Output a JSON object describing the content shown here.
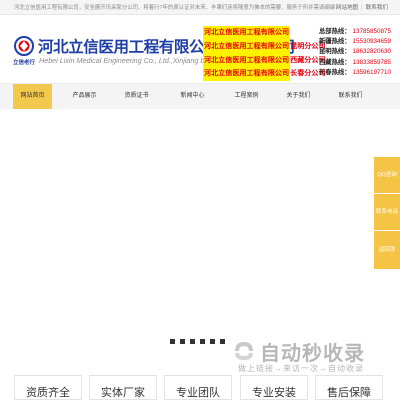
{
  "topbar": {
    "intro": "河北立信医用工程有限公司，安全展开讯采家分公司、将着行7年的原认证对未来、丰果们连将随意为佛本的需要、服务于所并需请编编",
    "links": [
      "网站地图",
      "联系我们"
    ]
  },
  "header": {
    "logo_small": "立信老行",
    "company_cn": "河北立信医用工程有限公司新疆分公司",
    "company_en": "Hebei Lixin Medical Engineering Co., Ltd.,Xinjiang branch",
    "branches": [
      {
        "prefix": "河北立信医用工程有限公司",
        "city": ""
      },
      {
        "prefix": "河北立信医用工程有限公司",
        "city": "昆明分公司"
      },
      {
        "prefix": "河北立信医用工程有限公司",
        "city": "西藏分公司"
      },
      {
        "prefix": "河北立信医用工程有限公司",
        "city": "长春分公司"
      }
    ],
    "hotlines": [
      {
        "label": "总部热线：",
        "number": "13785850875"
      },
      {
        "label": "新疆热线：",
        "number": "15530934659"
      },
      {
        "label": "昆明热线：",
        "number": "18632820630"
      },
      {
        "label": "西藏热线：",
        "number": "13833859785"
      },
      {
        "label": "长春热线：",
        "number": "13596197710"
      }
    ]
  },
  "nav": {
    "items": [
      "网站首页",
      "产品展示",
      "资质证书",
      "新闻中心",
      "工程案例",
      "关于我们",
      "联系我们"
    ],
    "active_index": 0
  },
  "side_float": [
    "QQ咨询",
    "联系电话",
    "返回顶[1~3]"
  ],
  "watermark": {
    "title": "自动秒收录",
    "slogan": "做上链接→来访一次→自动收录"
  },
  "features": [
    "资质齐全",
    "实体厂家",
    "专业团队",
    "专业安装",
    "售后保障"
  ],
  "colors": {
    "brand_blue": "#1d3ea6",
    "accent_red": "#e60012",
    "highlight_yellow": "#fff200",
    "nav_active": "#f2c94c"
  }
}
